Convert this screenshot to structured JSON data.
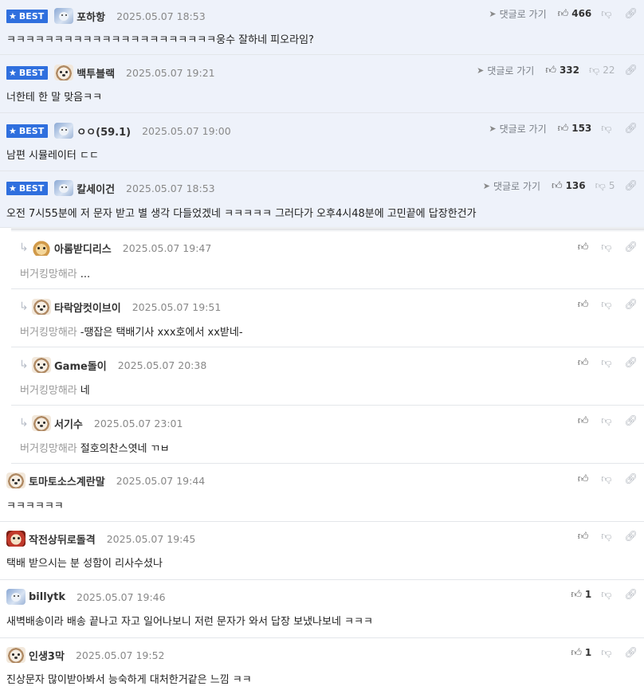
{
  "ui": {
    "best_label": "BEST",
    "goto_label": "댓글로 가기",
    "tag_user": "버거킹망해라"
  },
  "colors": {
    "best_bg": "#eef2fa",
    "badge_blue": "#2f6fde"
  },
  "icons": {
    "star": "star-icon",
    "thumbs_up": "thumbs-up-icon",
    "thumbs_down": "thumbs-down-icon",
    "link": "link-icon",
    "goto": "send-arrow-icon",
    "reply": "reply-arrow-icon"
  },
  "best_comments": [
    {
      "nick": "포하항",
      "date": "2025.05.07 18:53",
      "text": "ㅋㅋㅋㅋㅋㅋㅋㅋㅋㅋㅋㅋㅋㅋㅋㅋㅋㅋㅋㅋㅋㅋ웅수 잘하네 피오라임?",
      "likes": "466",
      "dislikes": ""
    },
    {
      "nick": "백투블랙",
      "date": "2025.05.07 19:21",
      "text": "너한테 한 말 맞음ㅋㅋ",
      "likes": "332",
      "dislikes": "22"
    },
    {
      "nick": "ㅇㅇ(59.1)",
      "date": "2025.05.07 19:00",
      "text": "남편 시뮬레이터 ㄷㄷ",
      "likes": "153",
      "dislikes": ""
    },
    {
      "nick": "칼세이건",
      "date": "2025.05.07 18:53",
      "text": "오전 7시55분에 저 문자 받고 별 생각 다들었겠네 ㅋㅋㅋㅋㅋ 그러다가 오후4시48분에 고민끝에 답장한건가",
      "likes": "136",
      "dislikes": "5"
    }
  ],
  "replies": [
    {
      "nick": "아롬받디리스",
      "date": "2025.05.07 19:47",
      "text": "...",
      "likes": ""
    },
    {
      "nick": "타락암컷이브이",
      "date": "2025.05.07 19:51",
      "text": "-땡잡은 택배기사 xxx호에서 xx받네-",
      "likes": ""
    },
    {
      "nick": "Game돌이",
      "date": "2025.05.07 20:38",
      "text": "네",
      "likes": ""
    },
    {
      "nick": "서기수",
      "date": "2025.05.07 23:01",
      "text": "절호의찬스엿네 ㄲㅂ",
      "likes": ""
    }
  ],
  "comments": [
    {
      "nick": "토마토소스계란말",
      "date": "2025.05.07 19:44",
      "text": "ㅋㅋㅋㅋㅋㅋ",
      "likes": ""
    },
    {
      "nick": "작전상뒤로돌격",
      "date": "2025.05.07 19:45",
      "text": "택배 받으시는 분 성함이 리사수셨나",
      "likes": ""
    },
    {
      "nick": "billytk",
      "date": "2025.05.07 19:46",
      "text": "새벽배송이라 배송 끝나고 자고 일어나보니 저런 문자가 와서 답장 보냈나보네 ㅋㅋㅋ",
      "likes": "1"
    },
    {
      "nick": "인생3막",
      "date": "2025.05.07 19:52",
      "text": "진상문자 많이받아봐서 능숙하게 대처한거같은 느낌 ㅋㅋ",
      "likes": "1"
    }
  ]
}
